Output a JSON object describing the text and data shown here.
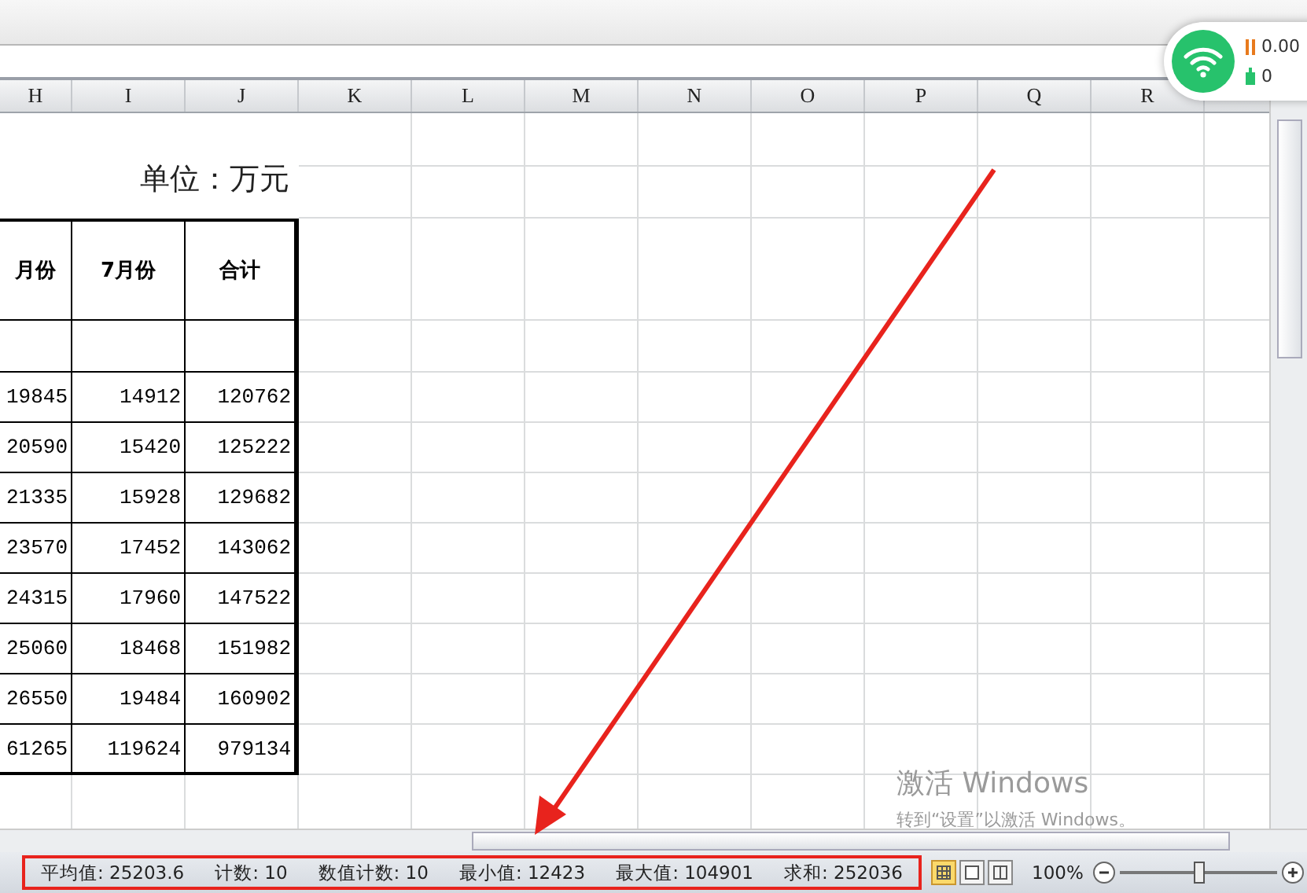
{
  "columns": [
    "H",
    "I",
    "J",
    "K",
    "L",
    "M",
    "N",
    "O",
    "P",
    "Q",
    "R"
  ],
  "unit": "单位：万元",
  "table": {
    "header": [
      "月份",
      "7月份",
      "合计"
    ],
    "rows": [
      [
        "19845",
        "14912",
        "120762"
      ],
      [
        "20590",
        "15420",
        "125222"
      ],
      [
        "21335",
        "15928",
        "129682"
      ],
      [
        "23570",
        "17452",
        "143062"
      ],
      [
        "24315",
        "17960",
        "147522"
      ],
      [
        "25060",
        "18468",
        "151982"
      ],
      [
        "26550",
        "19484",
        "160902"
      ],
      [
        "61265",
        "119624",
        "979134"
      ]
    ]
  },
  "network": {
    "speed": "0.00",
    "count": "0"
  },
  "activation": {
    "title": "激活 Windows",
    "hint": "转到“设置”以激活 Windows。"
  },
  "status_bar": {
    "items": [
      "平均值: 25203.6",
      "计数: 10",
      "数值计数: 10",
      "最小值: 12423",
      "最大值: 104901",
      "求和: 252036"
    ],
    "views": [
      {
        "kind": "normal",
        "selected": true
      },
      {
        "kind": "layout",
        "selected": false
      },
      {
        "kind": "pagebreak",
        "selected": false
      }
    ],
    "zoom": "100%",
    "zoom_slider": {
      "level": 0.5
    }
  }
}
